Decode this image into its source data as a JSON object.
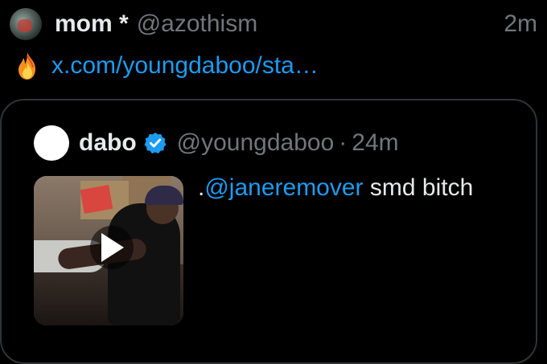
{
  "tweet": {
    "author_name": "mom *",
    "author_handle": "@azothism",
    "timestamp": "2m",
    "emoji_icon": "fire-icon",
    "link_text": "x.com/youngdaboo/sta…"
  },
  "quoted_tweet": {
    "author_name": "dabo",
    "verified_icon": "verified-badge-icon",
    "author_handle": "@youngdaboo",
    "separator": "·",
    "timestamp": "24m",
    "text_prefix": ".",
    "mention": "@janeremover",
    "text_rest": " smd bitch",
    "media_type": "video"
  },
  "colors": {
    "background": "#000000",
    "text_primary": "#e7e9ea",
    "text_secondary": "#71767b",
    "link": "#1d9bf0",
    "card_border": "#2f3336"
  }
}
